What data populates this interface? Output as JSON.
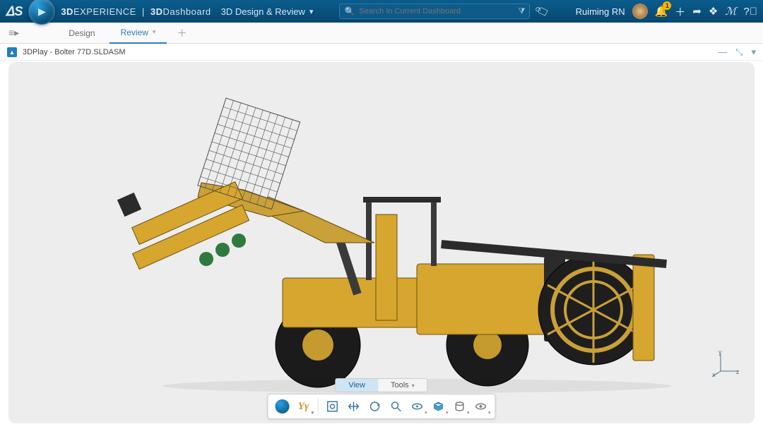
{
  "header": {
    "brand_bold": "3D",
    "brand_rest": "EXPERIENCE",
    "divider": "|",
    "brand2_bold": "3D",
    "brand2_rest": "Dashboard",
    "context": "3D Design & Review"
  },
  "search": {
    "placeholder": "Search In Current Dashboard"
  },
  "user": {
    "name": "Ruiming RN"
  },
  "notifications": {
    "count": "1"
  },
  "tabs": {
    "items": [
      "Design",
      "Review"
    ],
    "active_index": 1
  },
  "panel": {
    "title": "3DPlay - Bolter 77D.SLDASM"
  },
  "bottom_tabs": {
    "items": [
      "View",
      "Tools"
    ],
    "active_index": 0
  },
  "axis": {
    "x": "x",
    "y": "y",
    "z": "z"
  },
  "toolbar_icons": {
    "compass": "compass-icon",
    "axes": "axes-icon",
    "fit": "fit-icon",
    "pan": "pan-icon",
    "rotate": "rotate-icon",
    "zoom": "zoom-icon",
    "look": "look-icon",
    "display": "display-icon",
    "cylinder": "cylinder-icon",
    "eye": "eye-icon"
  }
}
